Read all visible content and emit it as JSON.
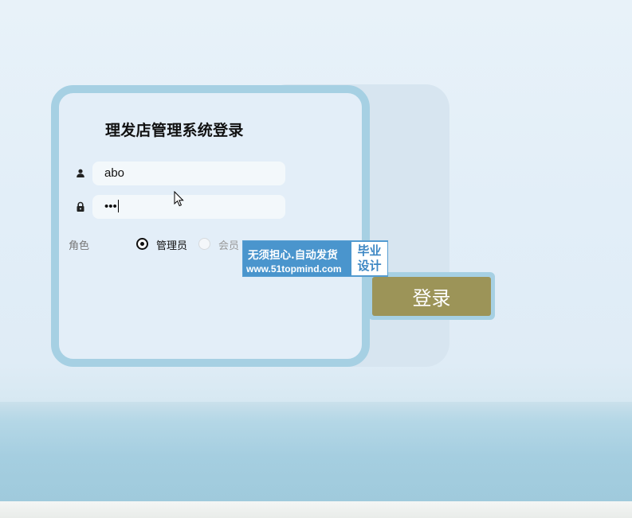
{
  "form": {
    "title": "理发店管理系统登录",
    "username_value": "abo",
    "password_value": "•••",
    "user_icon": "user-icon",
    "lock_icon": "lock-icon"
  },
  "role": {
    "label": "角色",
    "options": [
      {
        "label": "管理员",
        "selected": true
      },
      {
        "label": "会员",
        "selected": false
      }
    ]
  },
  "login_button": {
    "label": "登录"
  },
  "watermark": {
    "line1": "无须担心.自动发货",
    "line2": "www.51topmind.com",
    "badge_line1": "毕业",
    "badge_line2": "设计"
  },
  "colors": {
    "card_border": "#a6d0e3",
    "card_bg": "#e3eef8",
    "button_bg": "#9c9458",
    "watermark_bg": "#4a95cd"
  }
}
